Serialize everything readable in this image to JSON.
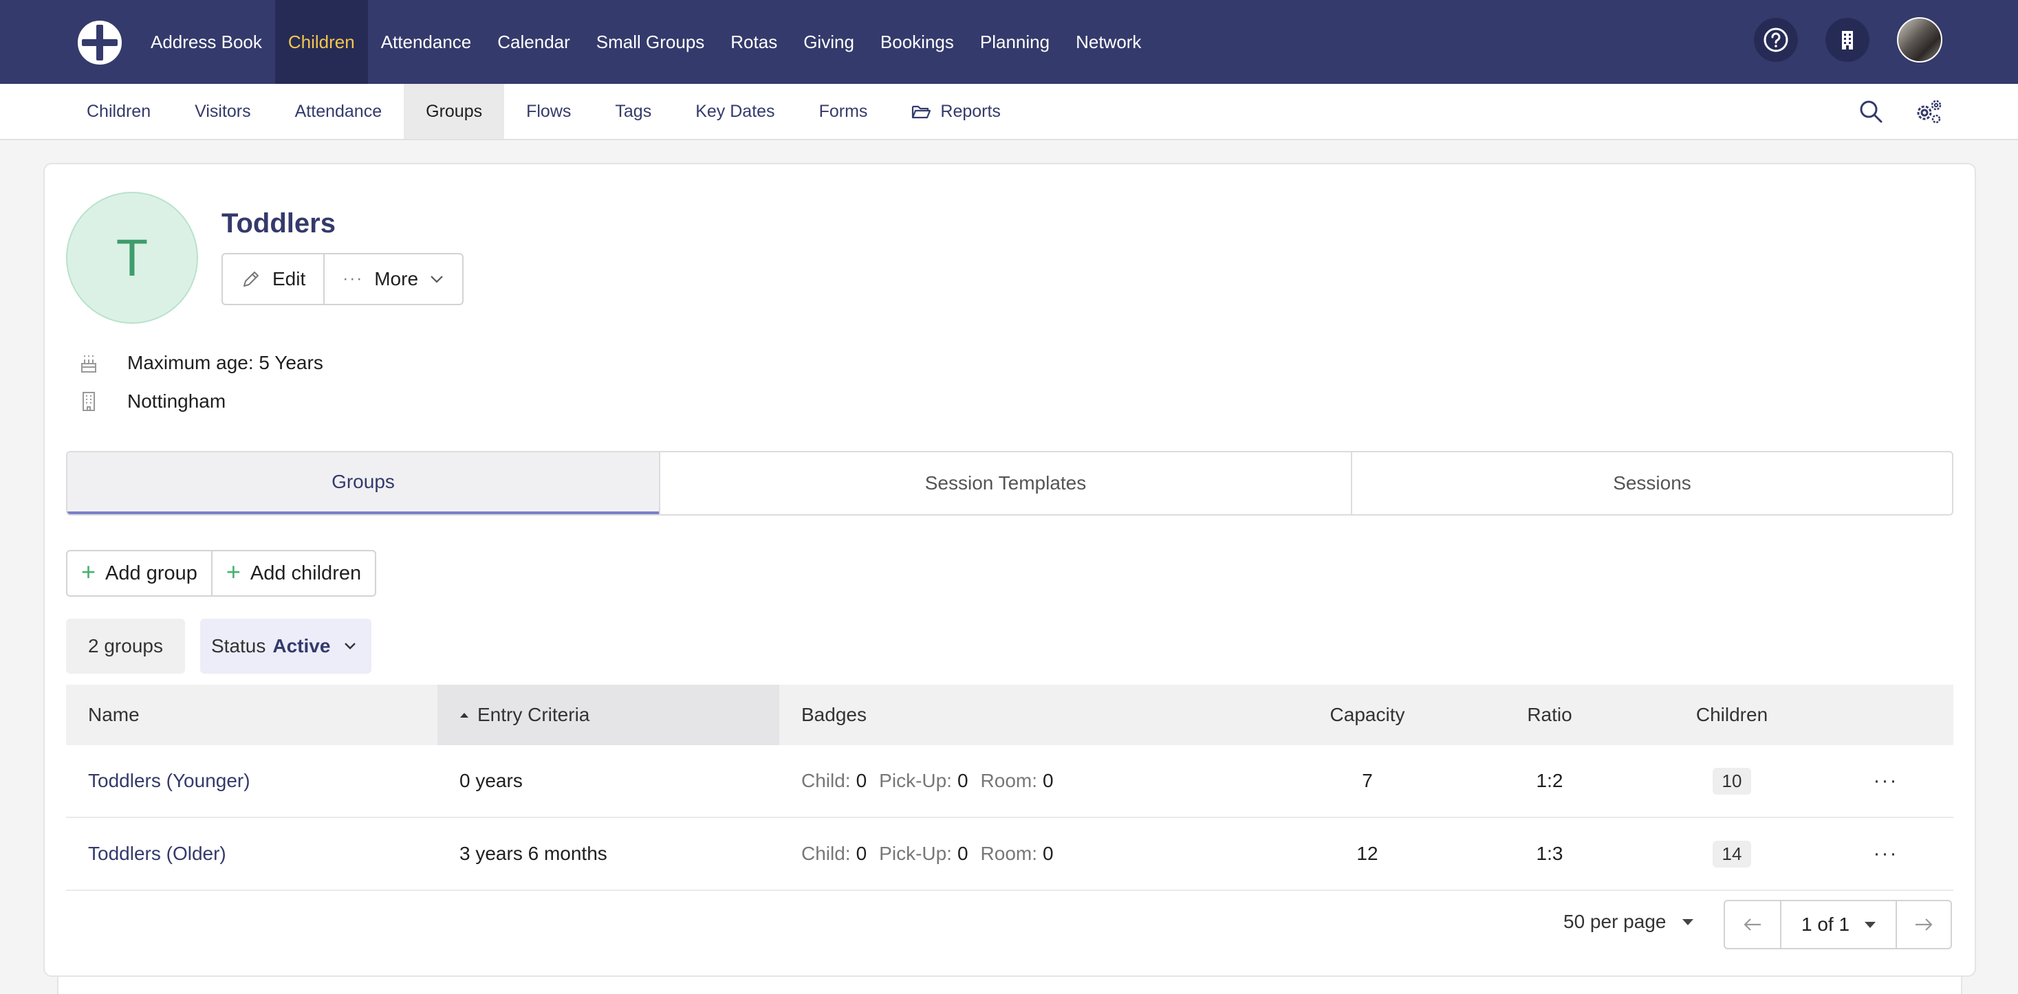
{
  "topnav": {
    "items": [
      {
        "label": "Address Book"
      },
      {
        "label": "Children"
      },
      {
        "label": "Attendance"
      },
      {
        "label": "Calendar"
      },
      {
        "label": "Small Groups"
      },
      {
        "label": "Rotas"
      },
      {
        "label": "Giving"
      },
      {
        "label": "Bookings"
      },
      {
        "label": "Planning"
      },
      {
        "label": "Network"
      }
    ],
    "active": "Children"
  },
  "subnav": {
    "items": [
      {
        "label": "Children"
      },
      {
        "label": "Visitors"
      },
      {
        "label": "Attendance"
      },
      {
        "label": "Groups"
      },
      {
        "label": "Flows"
      },
      {
        "label": "Tags"
      },
      {
        "label": "Key Dates"
      },
      {
        "label": "Forms"
      },
      {
        "label": "Reports",
        "icon": "folder-open-icon"
      }
    ],
    "active": "Groups"
  },
  "group": {
    "initial": "T",
    "title": "Toddlers",
    "edit_label": "Edit",
    "more_label": "More",
    "max_age": "Maximum age: 5 Years",
    "location": "Nottingham"
  },
  "tabs": [
    {
      "label": "Groups"
    },
    {
      "label": "Session Templates"
    },
    {
      "label": "Sessions"
    }
  ],
  "actions": {
    "add_group": "Add group",
    "add_children": "Add children"
  },
  "filters": {
    "count": "2 groups",
    "status_label": "Status",
    "status_value": "Active"
  },
  "table": {
    "headers": {
      "name": "Name",
      "entry": "Entry Criteria",
      "badges": "Badges",
      "capacity": "Capacity",
      "ratio": "Ratio",
      "children": "Children"
    },
    "badge_labels": {
      "child": "Child:",
      "pickup": "Pick-Up:",
      "room": "Room:"
    },
    "rows": [
      {
        "name": "Toddlers (Younger)",
        "entry": "0 years",
        "child": "0",
        "pickup": "0",
        "room": "0",
        "capacity": "7",
        "ratio": "1:2",
        "children": "10"
      },
      {
        "name": "Toddlers (Older)",
        "entry": "3 years 6 months",
        "child": "0",
        "pickup": "0",
        "room": "0",
        "capacity": "12",
        "ratio": "1:3",
        "children": "14"
      }
    ]
  },
  "pagination": {
    "per_page": "50 per page",
    "page": "1 of 1"
  },
  "colors": {
    "nav_bg": "#343a6b",
    "nav_active_text": "#f6c64a",
    "avatar_green": "#3f9c6c",
    "add_icon_green": "#47b26f"
  }
}
